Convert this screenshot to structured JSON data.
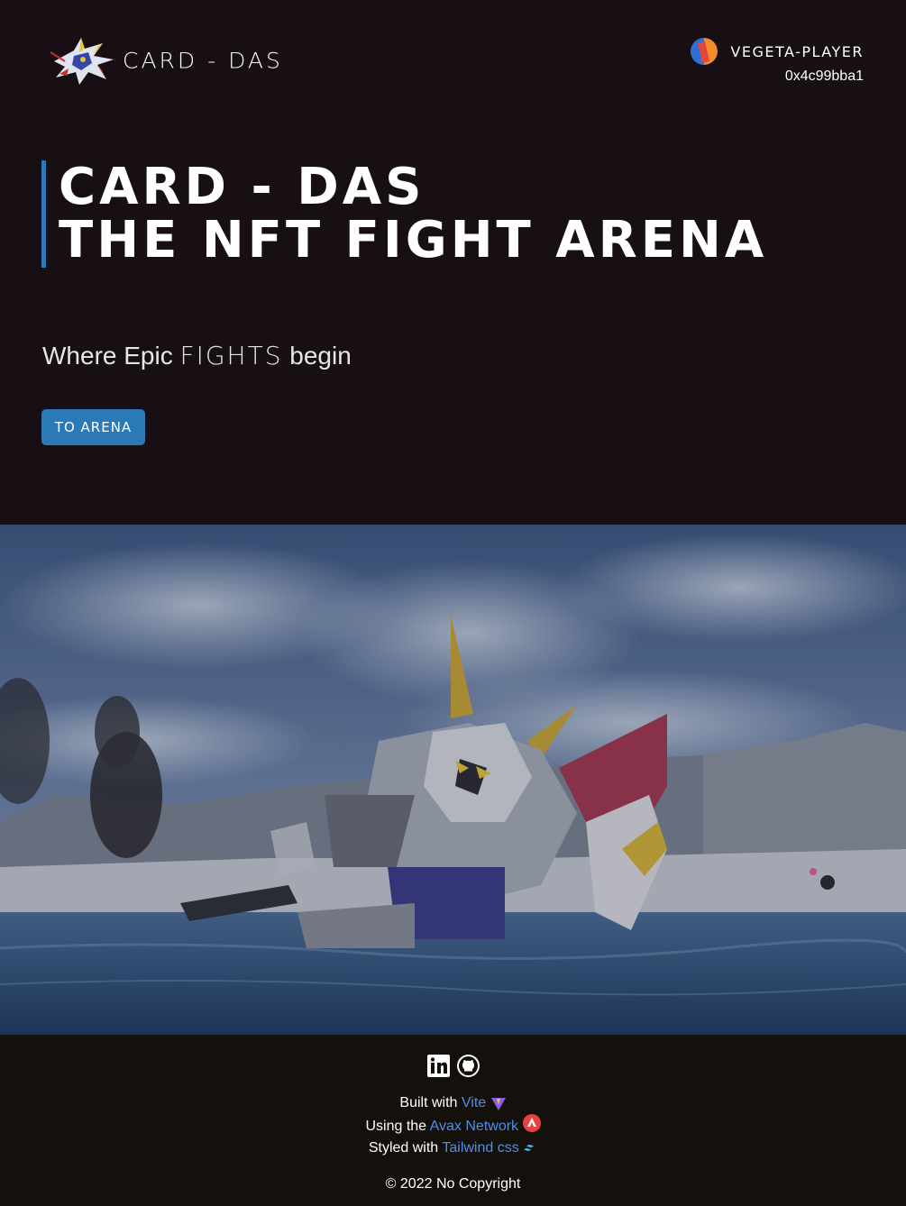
{
  "header": {
    "brand_name": "CARD - DAS",
    "player": {
      "name": "VEGETA-PLAYER",
      "address": "0x4c99bba1"
    }
  },
  "hero": {
    "title_line1": "CARD - DAS",
    "title_line2": "THE NFT FIGHT ARENA",
    "tagline_prefix": "Where Epic",
    "tagline_accent": "FIGHTS",
    "tagline_suffix": "begin",
    "cta_label": "TO ARENA"
  },
  "footer": {
    "built_prefix": "Built with",
    "built_link": "Vite",
    "using_prefix": "Using the",
    "using_link": "Avax Network",
    "styled_prefix": "Styled with",
    "styled_link": "Tailwind css",
    "copyright": "© 2022 No Copyright"
  },
  "colors": {
    "background": "#170f14",
    "accent_blue": "#2b7ab8",
    "link_blue": "#4d8ee8",
    "footer_background": "#14110d"
  },
  "icons": {
    "logo": "gundam-robot-logo",
    "avatar": "player-avatar-icon",
    "linkedin": "linkedin-icon",
    "github": "github-icon",
    "vite": "vite-icon",
    "avax": "avax-icon",
    "tailwind": "tailwind-icon"
  }
}
